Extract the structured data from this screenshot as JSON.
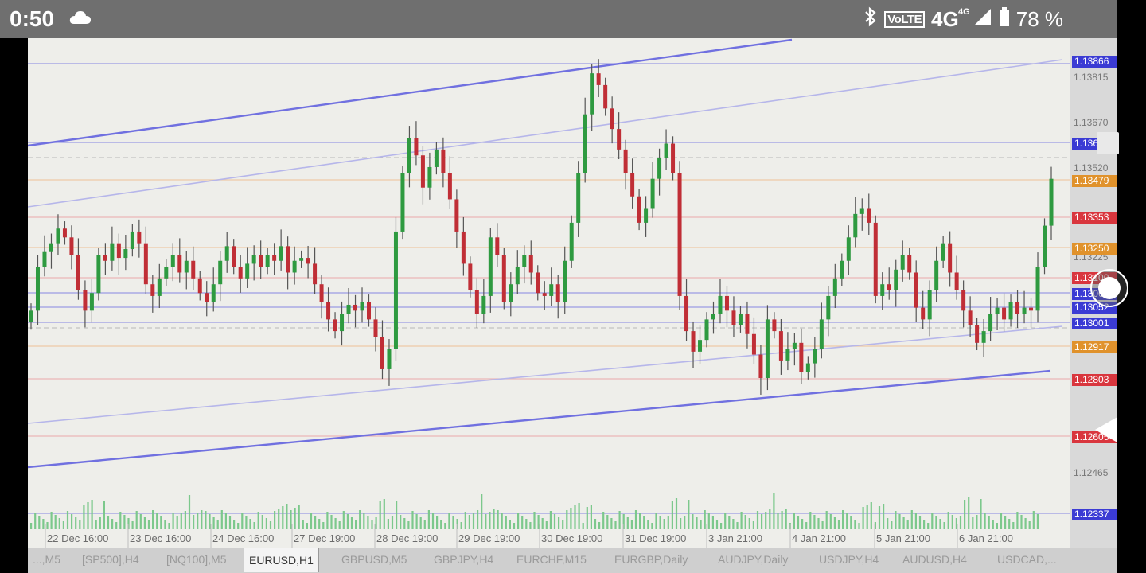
{
  "status_bar": {
    "time": "0:50",
    "volte": "VoLTE",
    "network": "4G",
    "network_sup": "4G",
    "battery": "78 %"
  },
  "chart_data": {
    "type": "candlestick",
    "symbol": "EURUSD",
    "timeframe": "H1",
    "time_labels": [
      "22 Dec 16:00",
      "23 Dec 16:00",
      "24 Dec 16:00",
      "27 Dec 19:00",
      "28 Dec 19:00",
      "29 Dec 19:00",
      "30 Dec 19:00",
      "31 Dec 19:00",
      "3 Jan 21:00",
      "4 Jan 21:00",
      "5 Jan 21:00",
      "6 Jan 21:00"
    ],
    "price_ticks": [
      "1.13815",
      "1.13670",
      "1.13520",
      "1.13225",
      "1.12465"
    ],
    "price_labels": [
      {
        "text": "1.13866",
        "color": "#3b3bd4"
      },
      {
        "text": "1.13601",
        "color": "#3b3bd4"
      },
      {
        "text": "1.13479",
        "color": "#e0922c"
      },
      {
        "text": "1.13353",
        "color": "#d9363e"
      },
      {
        "text": "1.13250",
        "color": "#e0922c"
      },
      {
        "text": "1.13100",
        "color": "#d9363e"
      },
      {
        "text": "1.13062",
        "color": "#3b3bd4"
      },
      {
        "text": "1.13052",
        "color": "#3b3bd4"
      },
      {
        "text": "1.13001",
        "color": "#3b3bd4"
      },
      {
        "text": "1.12917",
        "color": "#e0922c"
      },
      {
        "text": "1.12803",
        "color": "#d9363e"
      },
      {
        "text": "1.12605",
        "color": "#d9363e"
      },
      {
        "text": "1.12337",
        "color": "#3b3bd4"
      }
    ],
    "close_series": [
      1.1303,
      1.1318,
      1.1323,
      1.1326,
      1.1331,
      1.1328,
      1.1322,
      1.131,
      1.1303,
      1.1309,
      1.1322,
      1.132,
      1.1326,
      1.1321,
      1.1324,
      1.133,
      1.1326,
      1.1312,
      1.1308,
      1.1314,
      1.1318,
      1.1322,
      1.1316,
      1.132,
      1.1314,
      1.1309,
      1.1306,
      1.1312,
      1.132,
      1.1325,
      1.1318,
      1.1314,
      1.1319,
      1.1322,
      1.1318,
      1.1322,
      1.132,
      1.1325,
      1.1316,
      1.132,
      1.1321,
      1.1319,
      1.1312,
      1.1306,
      1.13,
      1.1296,
      1.1302,
      1.1305,
      1.1303,
      1.1306,
      1.13,
      1.1294,
      1.1283,
      1.129,
      1.133,
      1.135,
      1.1362,
      1.1356,
      1.1345,
      1.1352,
      1.1358,
      1.135,
      1.1341,
      1.133,
      1.1319,
      1.131,
      1.1302,
      1.1308,
      1.1328,
      1.1322,
      1.1306,
      1.1312,
      1.1318,
      1.1322,
      1.1316,
      1.1309,
      1.1308,
      1.1312,
      1.1306,
      1.132,
      1.1333,
      1.135,
      1.137,
      1.1384,
      1.138,
      1.1372,
      1.1365,
      1.1358,
      1.135,
      1.1342,
      1.1333,
      1.1338,
      1.1348,
      1.1355,
      1.136,
      1.135,
      1.1308,
      1.1296,
      1.1289,
      1.1293,
      1.13,
      1.1302,
      1.1308,
      1.1303,
      1.1298,
      1.1302,
      1.1295,
      1.1288,
      1.128,
      1.13,
      1.1296,
      1.1286,
      1.129,
      1.1292,
      1.1282,
      1.1285,
      1.129,
      1.13,
      1.1308,
      1.1314,
      1.132,
      1.1328,
      1.1336,
      1.1338,
      1.1333,
      1.1308,
      1.1312,
      1.131,
      1.1317,
      1.1322,
      1.1316,
      1.1304,
      1.13,
      1.131,
      1.132,
      1.1326,
      1.1316,
      1.131,
      1.1303,
      1.1298,
      1.1292,
      1.1296,
      1.1302,
      1.1304,
      1.13,
      1.1306,
      1.1302,
      1.1304,
      1.1303,
      1.1318,
      1.1332,
      1.1348
    ]
  },
  "tabs": [
    {
      "label": "...,M5",
      "active": false
    },
    {
      "label": "[SP500],H4",
      "active": false
    },
    {
      "label": "[NQ100],M5",
      "active": false
    },
    {
      "label": "EURUSD,H1",
      "active": true
    },
    {
      "label": "GBPUSD,M5",
      "active": false
    },
    {
      "label": "GBPJPY,H4",
      "active": false
    },
    {
      "label": "EURCHF,M15",
      "active": false
    },
    {
      "label": "EURGBP,Daily",
      "active": false
    },
    {
      "label": "AUDJPY,Daily",
      "active": false
    },
    {
      "label": "USDJPY,H4",
      "active": false
    },
    {
      "label": "AUDUSD,H4",
      "active": false
    },
    {
      "label": "USDCAD,...",
      "active": false
    }
  ]
}
